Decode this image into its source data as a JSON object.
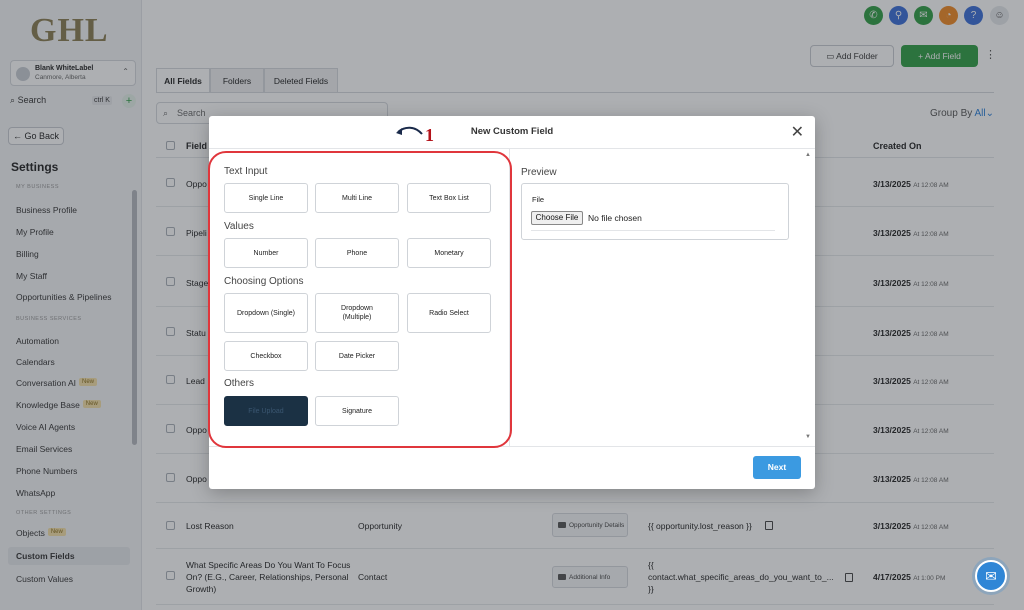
{
  "app": {
    "logo": "GHL"
  },
  "account": {
    "name": "Blank WhiteLabel",
    "location": "Canmore, Alberta"
  },
  "sidebar": {
    "search_label": "Search",
    "search_shortcut": "ctrl K",
    "go_back": "← Go Back",
    "title": "Settings",
    "section_my_business": "MY BUSINESS",
    "section_business_services": "BUSINESS SERVICES",
    "section_other_settings": "OTHER SETTINGS",
    "items": {
      "business_profile": "Business Profile",
      "my_profile": "My Profile",
      "billing": "Billing",
      "my_staff": "My Staff",
      "opportunities": "Opportunities & Pipelines",
      "automation": "Automation",
      "calendars": "Calendars",
      "conversation_ai": "Conversation AI",
      "knowledge_base": "Knowledge Base",
      "voice_ai": "Voice AI Agents",
      "email_services": "Email Services",
      "phone_numbers": "Phone Numbers",
      "whatsapp": "WhatsApp",
      "objects": "Objects",
      "custom_fields": "Custom Fields",
      "custom_values": "Custom Values"
    },
    "badge_new": "New"
  },
  "toolbar": {
    "add_folder": "Add Folder",
    "add_field": "+ Add Field"
  },
  "tabs": [
    "All Fields",
    "Folders",
    "Deleted Fields"
  ],
  "list": {
    "search_placeholder": "Search",
    "group_by": "Group By",
    "group_by_value": "All",
    "columns": {
      "field": "Field",
      "created": "Created On"
    },
    "rows": [
      {
        "name": "Oppo",
        "created": "3/13/2025",
        "time": "At 12:08 AM"
      },
      {
        "name": "Pipeli",
        "created": "3/13/2025",
        "time": "At 12:08 AM"
      },
      {
        "name": "Stage",
        "created": "3/13/2025",
        "time": "At 12:08 AM"
      },
      {
        "name": "Statu",
        "created": "3/13/2025",
        "time": "At 12:08 AM"
      },
      {
        "name": "Lead",
        "created": "3/13/2025",
        "time": "At 12:08 AM"
      },
      {
        "name": "Oppo",
        "created": "3/13/2025",
        "time": "At 12:08 AM"
      },
      {
        "name": "Oppo",
        "created": "3/13/2025",
        "time": "At 12:08 AM"
      }
    ],
    "full_rows": [
      {
        "name": "Lost Reason",
        "object": "Opportunity",
        "folder": "Opportunity Details",
        "key": "{{ opportunity.lost_reason }}",
        "created": "3/13/2025",
        "time": "At 12:08 AM"
      },
      {
        "name": "What Specific Areas Do You Want To Focus On? (E.G., Career, Relationships, Personal Growth)",
        "object": "Contact",
        "folder": "Additional Info",
        "key": "{{ contact.what_specific_areas_do_you_want_to_... }}",
        "created": "4/17/2025",
        "time": "At 1:00 PM"
      }
    ]
  },
  "modal": {
    "title": "New Custom Field",
    "groups": {
      "text_input": "Text Input",
      "values": "Values",
      "choosing": "Choosing Options",
      "others": "Others"
    },
    "types": {
      "single_line": "Single Line",
      "multi_line": "Multi Line",
      "text_box_list": "Text Box List",
      "number": "Number",
      "phone": "Phone",
      "monetary": "Monetary",
      "dropdown_single": "Dropdown (Single)",
      "dropdown_multiple": "Dropdown (Multiple)",
      "radio_select": "Radio Select",
      "checkbox": "Checkbox",
      "date_picker": "Date Picker",
      "file_upload": "File Upload",
      "signature": "Signature"
    },
    "preview_label": "Preview",
    "preview_field_label": "File",
    "choose_file": "Choose File",
    "no_file": "No file chosen",
    "next": "Next"
  },
  "annotation": {
    "step": "1"
  },
  "colors": {
    "accent_green": "#2f9e44",
    "next_blue": "#3b9ae1",
    "highlight_red": "#e0363c"
  }
}
